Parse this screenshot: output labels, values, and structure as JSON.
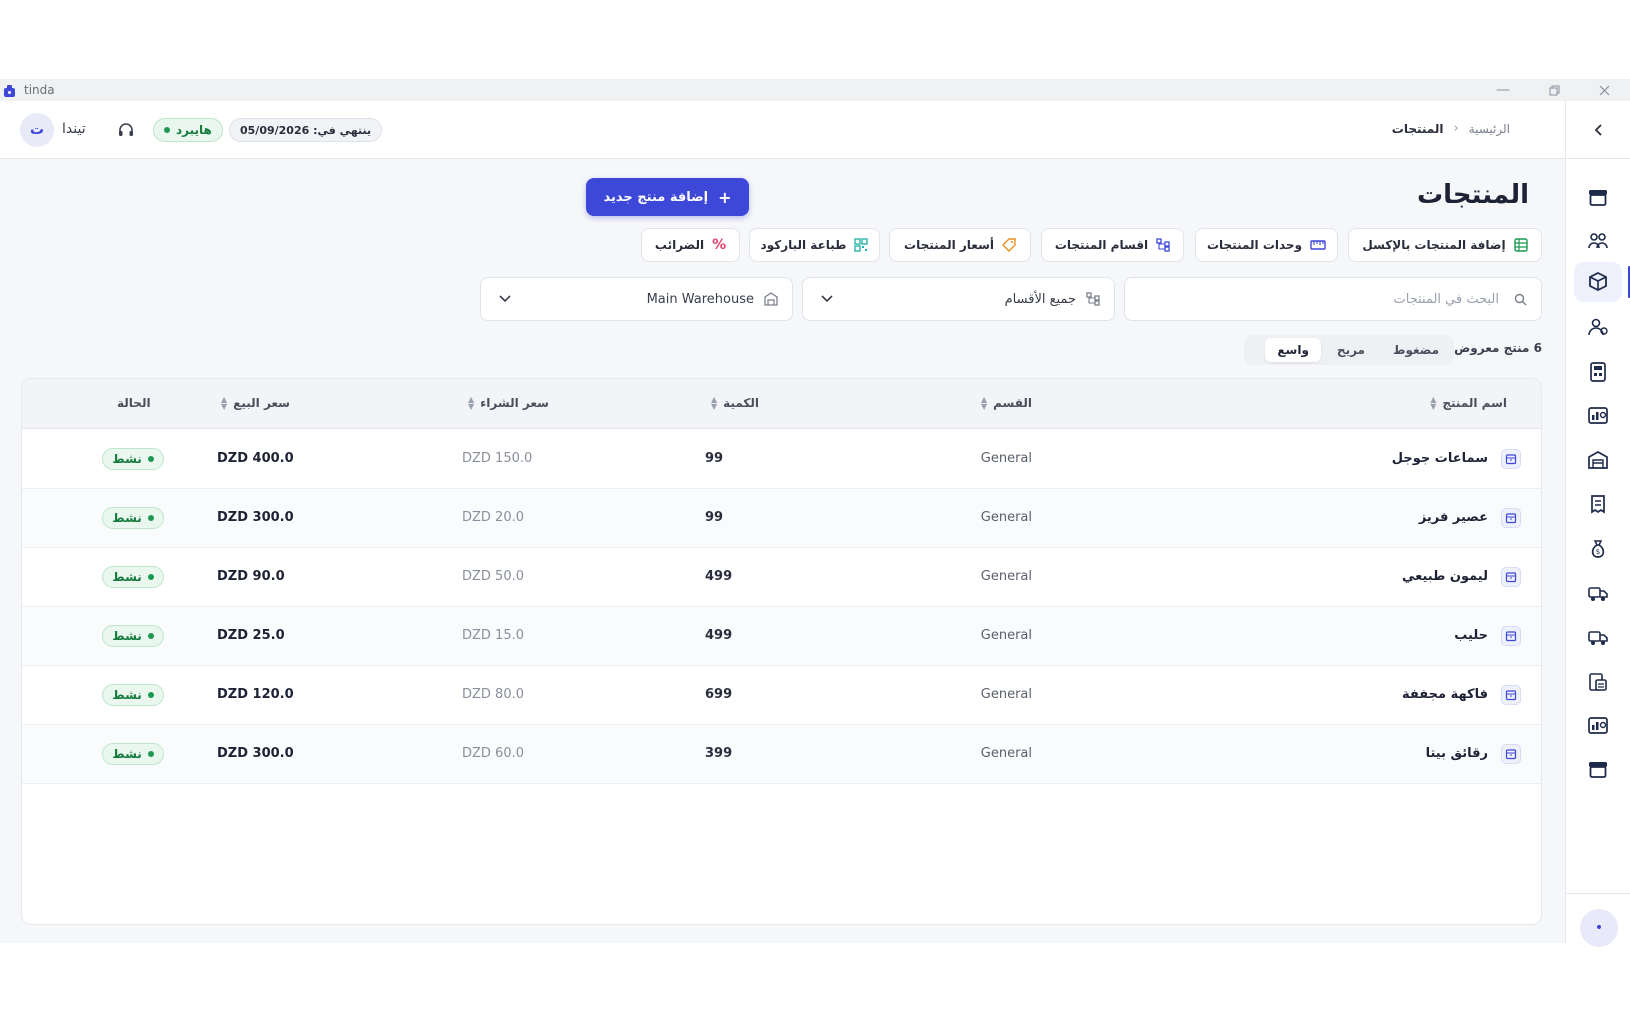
{
  "window": {
    "title": "tinda"
  },
  "user": {
    "avatar_letter": "ت",
    "name": "تيندا"
  },
  "badges": {
    "plan": "هايبرد",
    "expiry": "ينتهي في: 05/09/2026"
  },
  "breadcrumb": {
    "home": "الرئيسية",
    "current": "المنتجات"
  },
  "page": {
    "title": "المنتجات",
    "add_button": "إضافة منتج جديد"
  },
  "toolbar": [
    {
      "label": "إضافة المنتجات بالإكسل",
      "icon": "spreadsheet-icon"
    },
    {
      "label": "وحدات المنتجات",
      "icon": "ruler-icon"
    },
    {
      "label": "اقسام المنتجات",
      "icon": "hierarchy-icon"
    },
    {
      "label": "أسعار المنتجات",
      "icon": "tag-icon"
    },
    {
      "label": "طباعة الباركود",
      "icon": "qrcode-icon"
    },
    {
      "label": "الضرائب",
      "icon": "percent-icon"
    }
  ],
  "filters": {
    "search_placeholder": "البحث في المنتجات",
    "category": "جميع الأقسام",
    "warehouse": "Main Warehouse"
  },
  "density": {
    "count_label": "6 منتج معروض",
    "options": [
      "مضغوط",
      "مريح",
      "واسع"
    ],
    "selected": "واسع"
  },
  "table": {
    "headers": {
      "name": "اسم المنتج",
      "category": "القسم",
      "qty": "الكمية",
      "buy": "سعر الشراء",
      "sell": "سعر البيع",
      "status": "الحالة"
    },
    "rows": [
      {
        "name": "سماعات جوجل",
        "category": "General",
        "qty": "99",
        "buy": "DZD 150.0",
        "sell": "DZD 400.0",
        "status": "نشط"
      },
      {
        "name": "عصير فريز",
        "category": "General",
        "qty": "99",
        "buy": "DZD 20.0",
        "sell": "DZD 300.0",
        "status": "نشط"
      },
      {
        "name": "ليمون طبيعي",
        "category": "General",
        "qty": "499",
        "buy": "DZD 50.0",
        "sell": "DZD 90.0",
        "status": "نشط"
      },
      {
        "name": "حليب",
        "category": "General",
        "qty": "499",
        "buy": "DZD 15.0",
        "sell": "DZD 25.0",
        "status": "نشط"
      },
      {
        "name": "فاكهة مجففة",
        "category": "General",
        "qty": "699",
        "buy": "DZD 80.0",
        "sell": "DZD 120.0",
        "status": "نشط"
      },
      {
        "name": "رقائق بيتا",
        "category": "General",
        "qty": "399",
        "buy": "DZD 60.0",
        "sell": "DZD 300.0",
        "status": "نشط"
      }
    ]
  },
  "colors": {
    "accent": "#3d47d8",
    "active_green": "#1b9950",
    "background": "#f6f7f9"
  }
}
